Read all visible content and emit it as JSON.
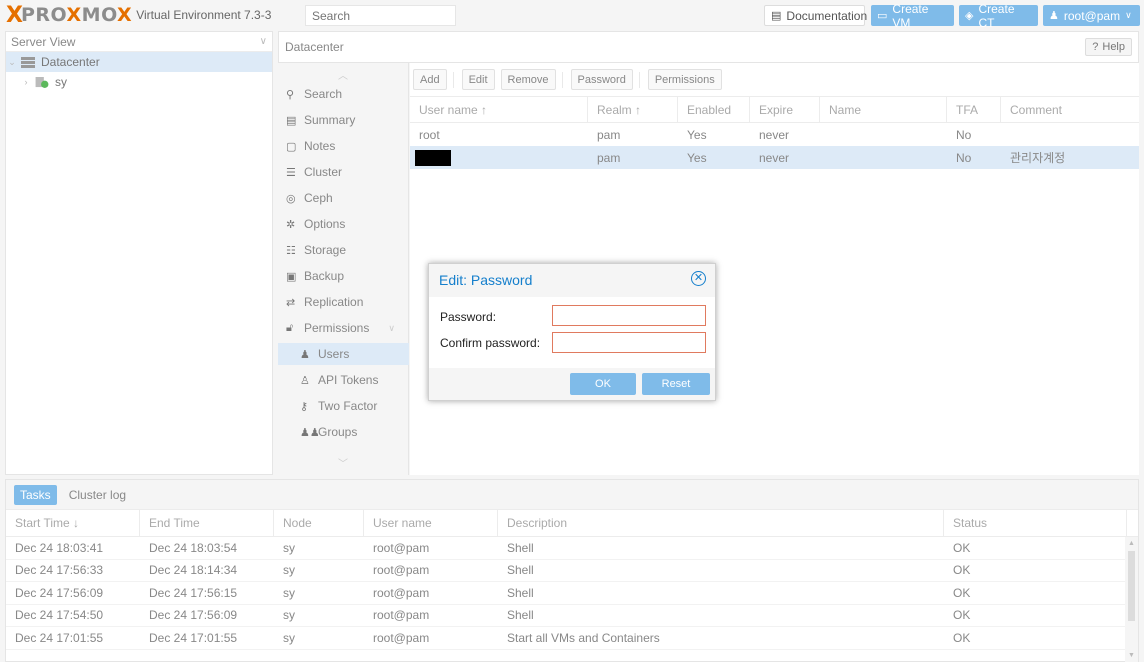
{
  "header": {
    "logo_prefix": "PRO",
    "logo_suffix": "MO",
    "logo_x": "X",
    "version": "Virtual Environment 7.3-3",
    "search_placeholder": "Search",
    "documentation_label": "Documentation",
    "create_vm_label": "Create VM",
    "create_ct_label": "Create CT",
    "user_label": "root@pam"
  },
  "left_panel": {
    "view_select": "Server View",
    "tree": [
      {
        "label": "Datacenter",
        "selected": true
      },
      {
        "label": "sy",
        "selected": false
      }
    ]
  },
  "main": {
    "breadcrumb": "Datacenter",
    "help_label": "Help",
    "nav_items": [
      {
        "label": "Search",
        "icon": "search-icon",
        "sub": false,
        "active": false
      },
      {
        "label": "Summary",
        "icon": "book-icon",
        "sub": false,
        "active": false
      },
      {
        "label": "Notes",
        "icon": "notes-icon",
        "sub": false,
        "active": false
      },
      {
        "label": "Cluster",
        "icon": "server-icon",
        "sub": false,
        "active": false
      },
      {
        "label": "Ceph",
        "icon": "ceph-icon",
        "sub": false,
        "active": false
      },
      {
        "label": "Options",
        "icon": "gear-icon",
        "sub": false,
        "active": false
      },
      {
        "label": "Storage",
        "icon": "database-icon",
        "sub": false,
        "active": false
      },
      {
        "label": "Backup",
        "icon": "floppy-icon",
        "sub": false,
        "active": false
      },
      {
        "label": "Replication",
        "icon": "retweet-icon",
        "sub": false,
        "active": false
      },
      {
        "label": "Permissions",
        "icon": "unlock-icon",
        "sub": false,
        "active": false
      },
      {
        "label": "Users",
        "icon": "user-icon",
        "sub": true,
        "active": true
      },
      {
        "label": "API Tokens",
        "icon": "user-outline-icon",
        "sub": true,
        "active": false
      },
      {
        "label": "Two Factor",
        "icon": "key-icon",
        "sub": true,
        "active": false
      },
      {
        "label": "Groups",
        "icon": "users-icon",
        "sub": true,
        "active": false
      }
    ],
    "toolbar": {
      "add": "Add",
      "edit": "Edit",
      "remove": "Remove",
      "password": "Password",
      "permissions": "Permissions"
    },
    "users_grid": {
      "columns": [
        "User name",
        "Realm",
        "Enabled",
        "Expire",
        "Name",
        "TFA",
        "Comment"
      ],
      "sort_arrow": "↑",
      "rows": [
        {
          "username": "root",
          "realm": "pam",
          "enabled": "Yes",
          "expire": "never",
          "name": "",
          "tfa": "No",
          "comment": "",
          "selected": false,
          "redacted": false
        },
        {
          "username": "",
          "realm": "pam",
          "enabled": "Yes",
          "expire": "never",
          "name": "",
          "tfa": "No",
          "comment": "관리자계정",
          "selected": true,
          "redacted": true
        }
      ]
    }
  },
  "modal": {
    "title": "Edit: Password",
    "password_label": "Password:",
    "confirm_label": "Confirm password:",
    "ok_label": "OK",
    "reset_label": "Reset"
  },
  "tasks": {
    "tabs": [
      {
        "label": "Tasks",
        "active": true
      },
      {
        "label": "Cluster log",
        "active": false
      }
    ],
    "columns": [
      "Start Time",
      "End Time",
      "Node",
      "User name",
      "Description",
      "Status"
    ],
    "sort_arrow": "↓",
    "rows": [
      {
        "start": "Dec 24 18:03:41",
        "end": "Dec 24 18:03:54",
        "node": "sy",
        "user": "root@pam",
        "desc": "Shell",
        "status": "OK"
      },
      {
        "start": "Dec 24 17:56:33",
        "end": "Dec 24 18:14:34",
        "node": "sy",
        "user": "root@pam",
        "desc": "Shell",
        "status": "OK"
      },
      {
        "start": "Dec 24 17:56:09",
        "end": "Dec 24 17:56:15",
        "node": "sy",
        "user": "root@pam",
        "desc": "Shell",
        "status": "OK"
      },
      {
        "start": "Dec 24 17:54:50",
        "end": "Dec 24 17:56:09",
        "node": "sy",
        "user": "root@pam",
        "desc": "Shell",
        "status": "OK"
      },
      {
        "start": "Dec 24 17:01:55",
        "end": "Dec 24 17:01:55",
        "node": "sy",
        "user": "root@pam",
        "desc": "Start all VMs and Containers",
        "status": "OK"
      }
    ]
  },
  "colors": {
    "accent": "#7fbbe9",
    "brand_orange": "#e57000",
    "selection": "#ddeaf7",
    "title_blue": "#157fcc"
  }
}
